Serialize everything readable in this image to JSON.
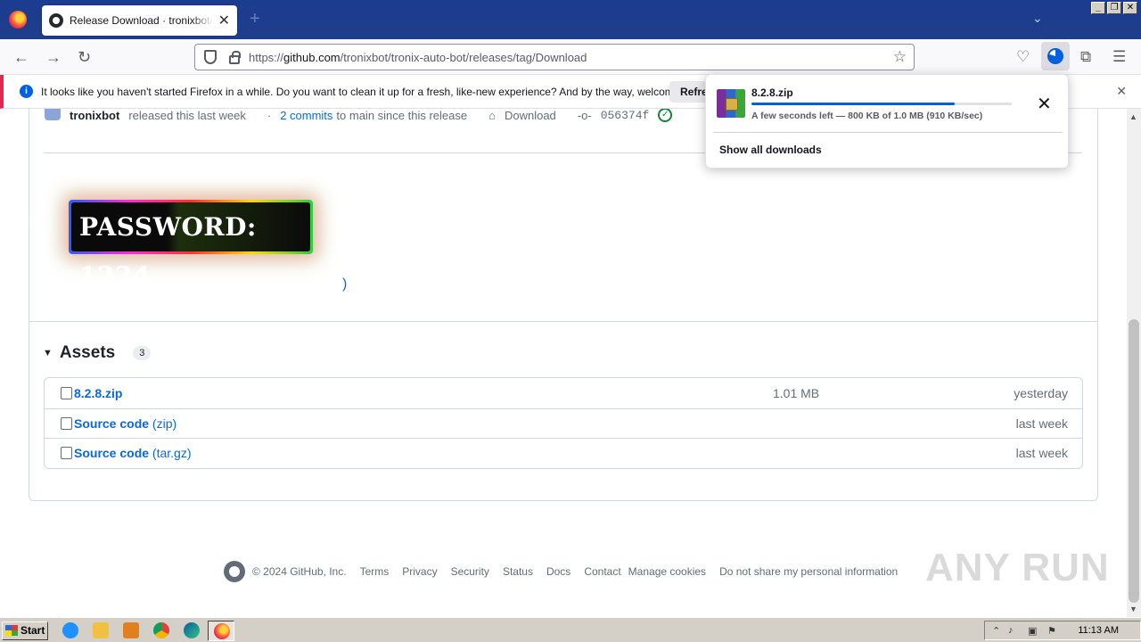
{
  "browser": {
    "tab_title": "Release Download · tronixbot/tronix-auto-bot",
    "tab_close": "✕",
    "new_tab": "+",
    "url_prefix": "https://",
    "url_host": "github.com",
    "url_path": "/tronixbot/tronix-auto-bot/releases/tag/Download"
  },
  "notification": {
    "message": "It looks like you haven't started Firefox in a while. Do you want to clean it up for a fresh, like-new experience? And by the way, welcome back!",
    "button": "Refresh Firefox…"
  },
  "release_meta": {
    "user": "tronixbot",
    "released": "released this last week",
    "commits_prefix": "·",
    "commits_link": "2 commits",
    "commits_suffix": "to main since this release",
    "tag": "Download",
    "commit_hash": "056374f"
  },
  "banner": {
    "text": "PASSWORD: 1234",
    "paren": ")"
  },
  "assets": {
    "heading": "Assets",
    "count": "3",
    "rows": [
      {
        "name": "8.2.8.zip",
        "suffix": "",
        "size": "1.01 MB",
        "when": "yesterday"
      },
      {
        "name": "Source code",
        "suffix": " (zip)",
        "size": "",
        "when": "last week"
      },
      {
        "name": "Source code",
        "suffix": " (tar.gz)",
        "size": "",
        "when": "last week"
      }
    ]
  },
  "footer": {
    "copyright": "© 2024 GitHub, Inc.",
    "links": [
      "Terms",
      "Privacy",
      "Security",
      "Status",
      "Docs",
      "Contact",
      "Manage cookies",
      "Do not share my personal information"
    ]
  },
  "watermark": "ANY RUN",
  "downloads_panel": {
    "file_name": "8.2.8.zip",
    "progress": 0.78,
    "status": "A few seconds left — 800 KB of 1.0 MB (910 KB/sec)",
    "show_all": "Show all downloads"
  },
  "taskbar": {
    "start": "Start",
    "time": "11:13 AM"
  }
}
